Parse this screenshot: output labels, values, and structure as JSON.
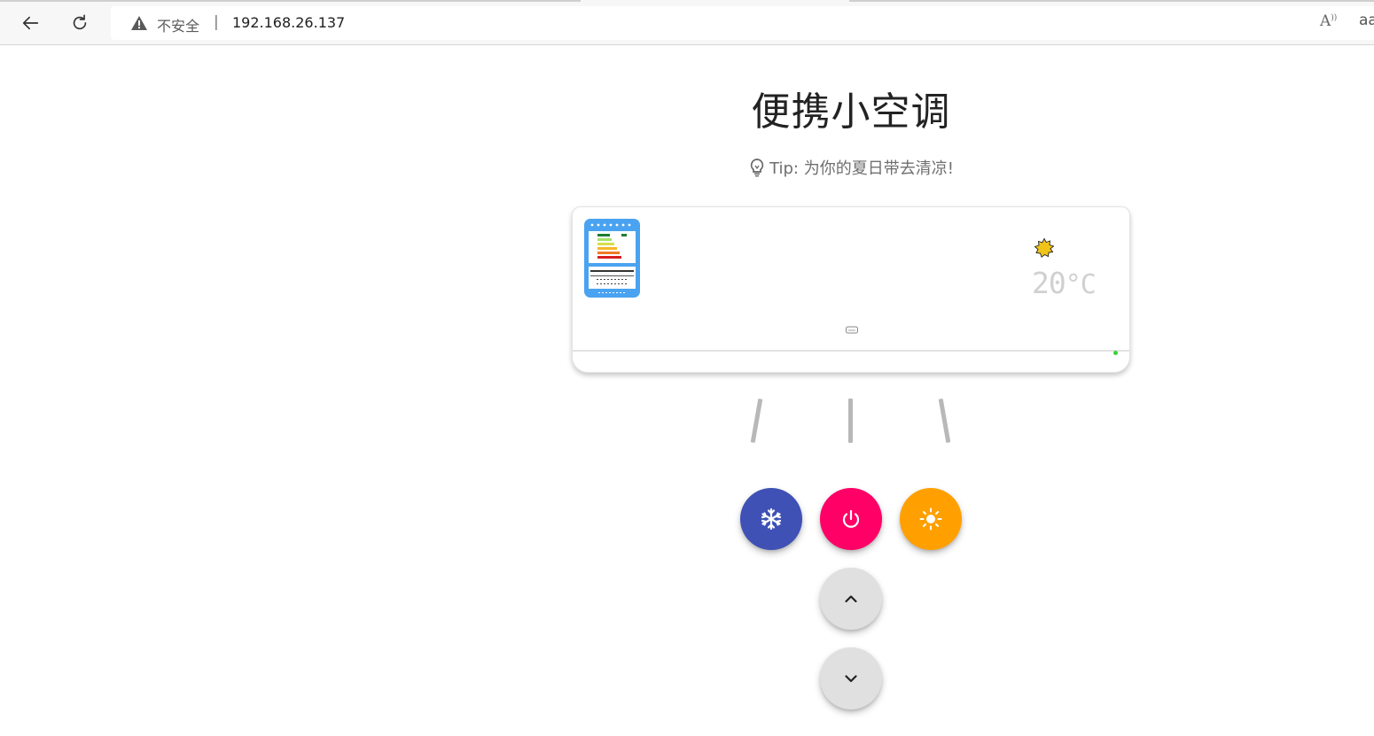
{
  "browser": {
    "address_bar": {
      "security_label": "不安全",
      "separator": "|",
      "url": "192.168.26.137"
    },
    "read_aloud_label": "A",
    "read_aloud_sup": "))",
    "text_size_label": "aa"
  },
  "page": {
    "title": "便携小空调",
    "tip": "Tip: 为你的夏日带去清凉!"
  },
  "air_conditioner": {
    "temperature_value": "20",
    "temperature_unit": "°C",
    "mode": "heat",
    "led_color": "#3ad33a"
  },
  "controls": {
    "cool_color": "#3f51b5",
    "power_color": "#ff0066",
    "heat_color": "#ffa000",
    "adjust_color": "#e0e0e0"
  },
  "icons": {
    "cool": "snowflake-icon",
    "power": "power-icon",
    "heat": "sun-icon",
    "up": "chevron-up-icon",
    "down": "chevron-down-icon"
  }
}
